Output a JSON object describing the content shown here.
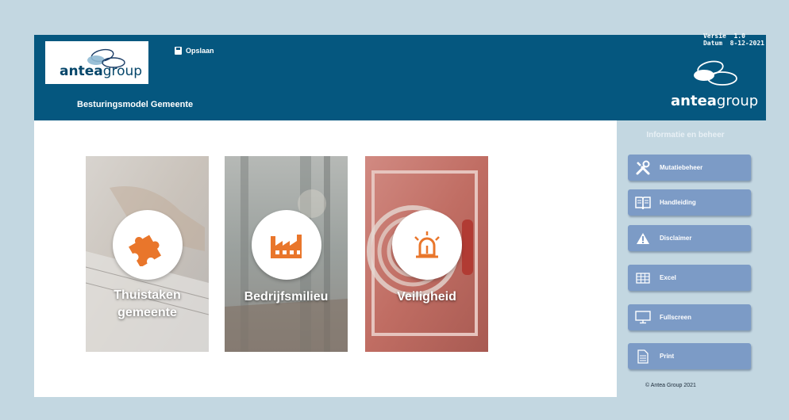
{
  "header": {
    "logo_text_bold": "antea",
    "logo_text_light": "group",
    "save_label": "Opslaan",
    "app_title": "Besturingsmodel Gemeente",
    "version_line": "Versie  1.0",
    "date_line": "Datum  8-12-2021",
    "right_logo_bold": "antea",
    "right_logo_light": "group"
  },
  "tiles": [
    {
      "label_line1": "Thuistaken",
      "label_line2": "gemeente",
      "icon": "puzzle-icon"
    },
    {
      "label_line1": "Bedrijfsmilieu",
      "icon": "factory-icon"
    },
    {
      "label_line1": "Veiligheid",
      "icon": "siren-icon"
    }
  ],
  "sidebar": {
    "title": "Informatie en beheer",
    "buttons": [
      {
        "label": "Mutatiebeheer",
        "icon": "tools-icon"
      },
      {
        "label": "Handleiding",
        "icon": "book-icon"
      },
      {
        "label": "Disclaimer",
        "icon": "warning-icon"
      },
      {
        "label": "Excel",
        "icon": "table-icon"
      },
      {
        "label": "Fullscreen",
        "icon": "monitor-icon"
      },
      {
        "label": "Print",
        "icon": "document-icon"
      }
    ],
    "copyright": "© Antea Group 2021"
  },
  "colors": {
    "header_bg": "#05577f",
    "accent_orange": "#e9762b",
    "button_bg": "#7c9bc6",
    "page_bg": "#c3d7e1"
  }
}
